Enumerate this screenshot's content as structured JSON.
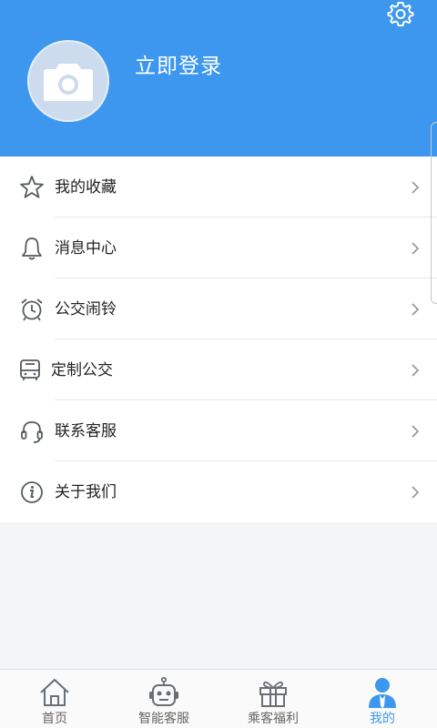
{
  "header": {
    "login_text": "立即登录"
  },
  "icons": {
    "settings": "gear-icon",
    "avatar": "camera-icon"
  },
  "colors": {
    "header_bg": "#3d97ee",
    "accent": "#3d97ee",
    "icon_gray": "#555a60"
  },
  "menu": {
    "items": [
      {
        "label": "我的收藏",
        "icon": "star-icon"
      },
      {
        "label": "消息中心",
        "icon": "bell-icon"
      },
      {
        "label": "公交闹铃",
        "icon": "alarm-clock-icon"
      },
      {
        "label": "定制公交",
        "icon": "bus-icon"
      },
      {
        "label": "联系客服",
        "icon": "headset-icon"
      },
      {
        "label": "关于我们",
        "icon": "info-icon"
      }
    ]
  },
  "tabbar": {
    "tabs": [
      {
        "label": "首页",
        "icon": "home-icon"
      },
      {
        "label": "智能客服",
        "icon": "robot-icon"
      },
      {
        "label": "乘客福利",
        "icon": "gift-icon"
      },
      {
        "label": "我的",
        "icon": "user-icon",
        "active": true
      }
    ]
  }
}
